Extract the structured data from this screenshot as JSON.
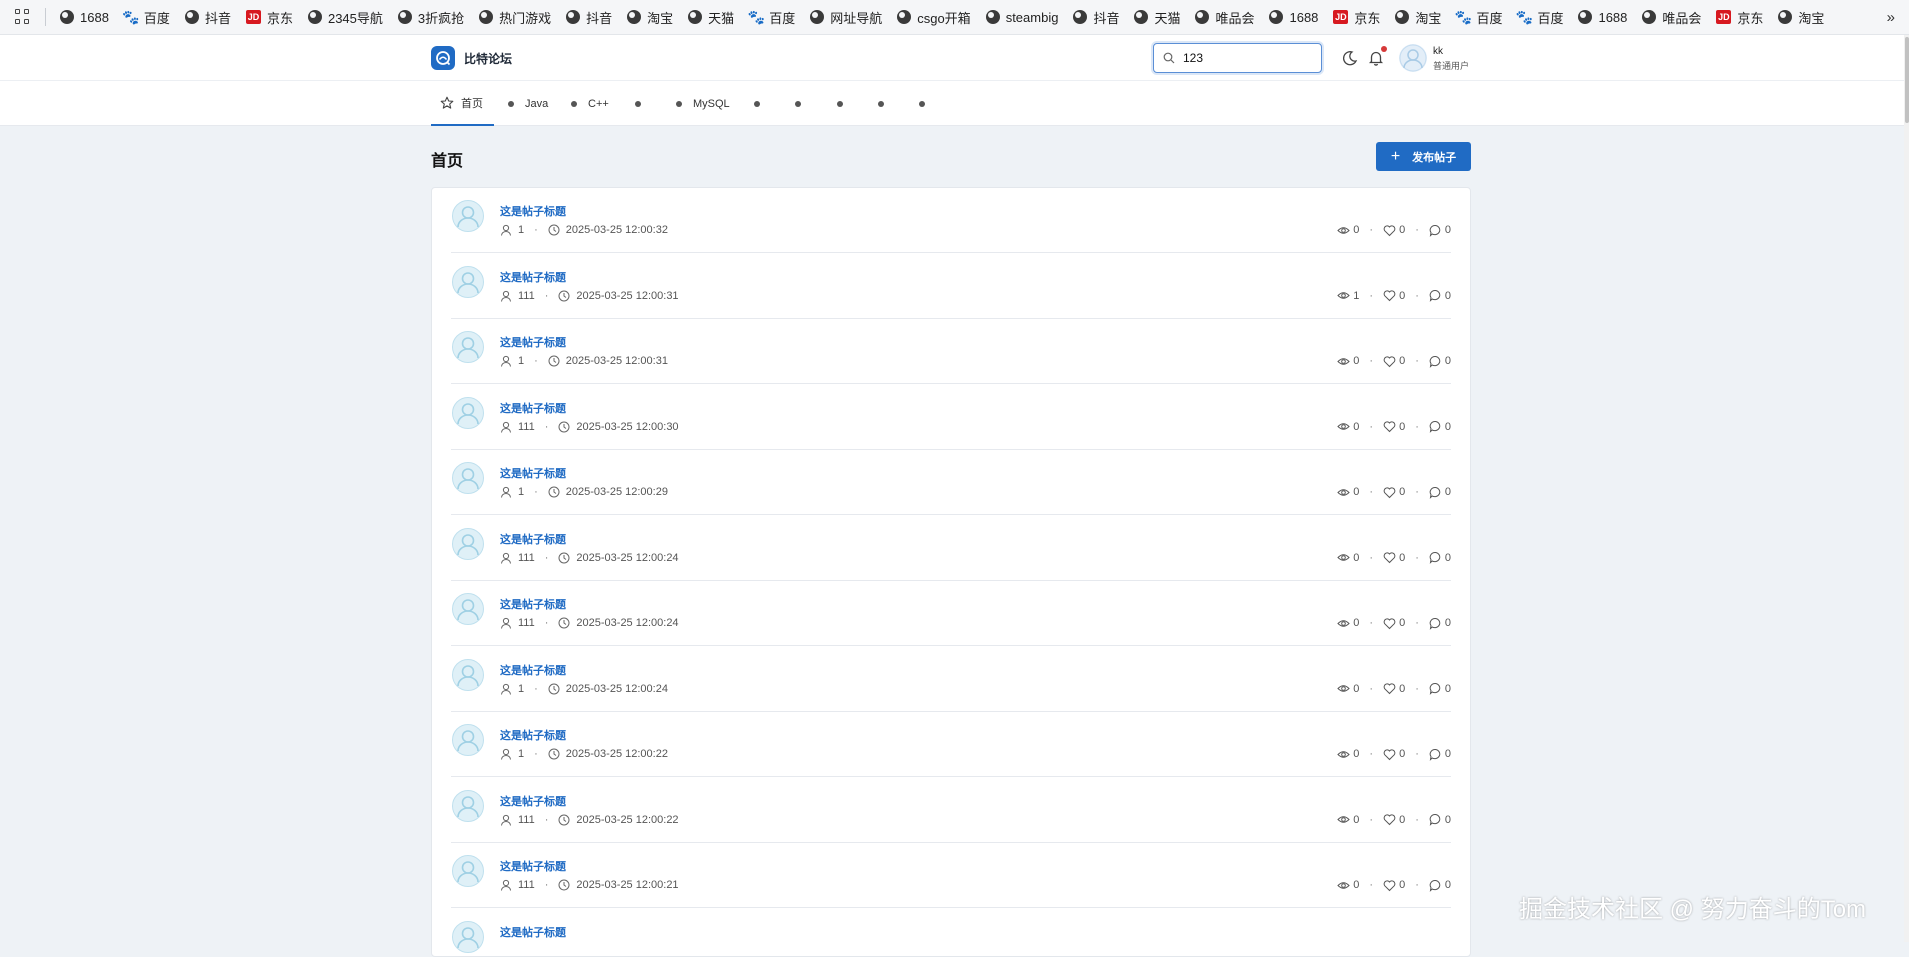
{
  "bookmarks": [
    {
      "label": "1688",
      "icon": "globe"
    },
    {
      "label": "百度",
      "icon": "baidu"
    },
    {
      "label": "抖音",
      "icon": "globe"
    },
    {
      "label": "京东",
      "icon": "jd"
    },
    {
      "label": "2345导航",
      "icon": "globe"
    },
    {
      "label": "3折疯抢",
      "icon": "globe"
    },
    {
      "label": "热门游戏",
      "icon": "globe"
    },
    {
      "label": "抖音",
      "icon": "globe"
    },
    {
      "label": "淘宝",
      "icon": "globe"
    },
    {
      "label": "天猫",
      "icon": "globe"
    },
    {
      "label": "百度",
      "icon": "baidu"
    },
    {
      "label": "网址导航",
      "icon": "globe"
    },
    {
      "label": "csgo开箱",
      "icon": "globe"
    },
    {
      "label": "steambig",
      "icon": "globe"
    },
    {
      "label": "抖音",
      "icon": "globe"
    },
    {
      "label": "天猫",
      "icon": "globe"
    },
    {
      "label": "唯品会",
      "icon": "globe"
    },
    {
      "label": "1688",
      "icon": "globe"
    },
    {
      "label": "京东",
      "icon": "jd"
    },
    {
      "label": "淘宝",
      "icon": "globe"
    },
    {
      "label": "百度",
      "icon": "baidu"
    },
    {
      "label": "百度",
      "icon": "baidu"
    },
    {
      "label": "1688",
      "icon": "globe"
    },
    {
      "label": "唯品会",
      "icon": "globe"
    },
    {
      "label": "京东",
      "icon": "jd"
    },
    {
      "label": "淘宝",
      "icon": "globe"
    }
  ],
  "bookmarks_more": "»",
  "header": {
    "site_name": "比特论坛",
    "search_value": "123",
    "user_name": "kk",
    "user_role": "普通用户"
  },
  "nav": {
    "home": "首页",
    "java": "Java",
    "cpp": "C++",
    "mysql": "MySQL"
  },
  "page": {
    "title": "首页",
    "publish_label": "发布帖子"
  },
  "posts": [
    {
      "title": "这是帖子标题",
      "author": "1",
      "time": "2025-03-25 12:00:32",
      "views": "0",
      "likes": "0",
      "comments": "0"
    },
    {
      "title": "这是帖子标题",
      "author": "111",
      "time": "2025-03-25 12:00:31",
      "views": "1",
      "likes": "0",
      "comments": "0"
    },
    {
      "title": "这是帖子标题",
      "author": "1",
      "time": "2025-03-25 12:00:31",
      "views": "0",
      "likes": "0",
      "comments": "0"
    },
    {
      "title": "这是帖子标题",
      "author": "111",
      "time": "2025-03-25 12:00:30",
      "views": "0",
      "likes": "0",
      "comments": "0"
    },
    {
      "title": "这是帖子标题",
      "author": "1",
      "time": "2025-03-25 12:00:29",
      "views": "0",
      "likes": "0",
      "comments": "0"
    },
    {
      "title": "这是帖子标题",
      "author": "111",
      "time": "2025-03-25 12:00:24",
      "views": "0",
      "likes": "0",
      "comments": "0"
    },
    {
      "title": "这是帖子标题",
      "author": "111",
      "time": "2025-03-25 12:00:24",
      "views": "0",
      "likes": "0",
      "comments": "0"
    },
    {
      "title": "这是帖子标题",
      "author": "1",
      "time": "2025-03-25 12:00:24",
      "views": "0",
      "likes": "0",
      "comments": "0"
    },
    {
      "title": "这是帖子标题",
      "author": "1",
      "time": "2025-03-25 12:00:22",
      "views": "0",
      "likes": "0",
      "comments": "0"
    },
    {
      "title": "这是帖子标题",
      "author": "111",
      "time": "2025-03-25 12:00:22",
      "views": "0",
      "likes": "0",
      "comments": "0"
    },
    {
      "title": "这是帖子标题",
      "author": "111",
      "time": "2025-03-25 12:00:21",
      "views": "0",
      "likes": "0",
      "comments": "0"
    },
    {
      "title": "这是帖子标题",
      "author": "",
      "time": "",
      "views": "",
      "likes": "",
      "comments": ""
    }
  ],
  "watermark": "掘金技术社区 @ 努力奋斗的Tom",
  "colors": {
    "accent": "#206bc4",
    "page_bg": "#eef2f6"
  }
}
